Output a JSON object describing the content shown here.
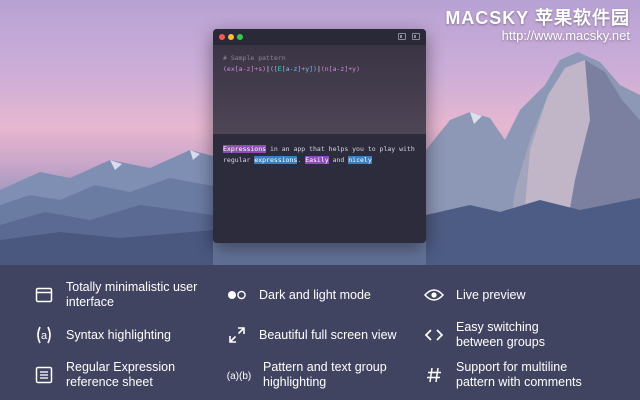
{
  "watermark": {
    "brand": "MACSKY 苹果软件园",
    "url": "http://www.macsky.net"
  },
  "window": {
    "comment": "# Sample pattern",
    "pattern": {
      "p1": "(ex[a-z]+s)",
      "sep1": "|",
      "p2": "([E[a-z]+y])",
      "sep2": "|",
      "p3": "(n[a-z]+y)"
    },
    "text": {
      "w1": "Expressions",
      "t1": " in an app that helps you to play with",
      "t2": "regular ",
      "w2": "expressions",
      "t3": ". ",
      "w3": "Easily",
      "t4": " and ",
      "w4": "nicely"
    }
  },
  "features": [
    {
      "id": "minimal-ui",
      "icon": "window-icon",
      "label": "Totally minimalistic user interface"
    },
    {
      "id": "dark-light",
      "icon": "toggle-icon",
      "label": "Dark and light mode"
    },
    {
      "id": "live-preview",
      "icon": "eye-icon",
      "label": "Live preview"
    },
    {
      "id": "syntax",
      "icon": "at-icon",
      "label": "Syntax highlighting"
    },
    {
      "id": "fullscreen",
      "icon": "expand-icon",
      "label": "Beautiful full screen view"
    },
    {
      "id": "switching",
      "icon": "code-brackets-icon",
      "label": "Easy switching between groups"
    },
    {
      "id": "reference",
      "icon": "list-icon",
      "label": "Regular Expression reference sheet"
    },
    {
      "id": "group-highlight",
      "icon": "group-icon",
      "label": "Pattern and text group highlighting"
    },
    {
      "id": "multiline",
      "icon": "hash-icon",
      "label": "Support for multiline pattern with comments"
    }
  ],
  "colors": {
    "panel": "#414461",
    "window": "#2c2b3c",
    "highlight_purple": "#8b4fb0",
    "highlight_blue": "#3b7fbd"
  }
}
